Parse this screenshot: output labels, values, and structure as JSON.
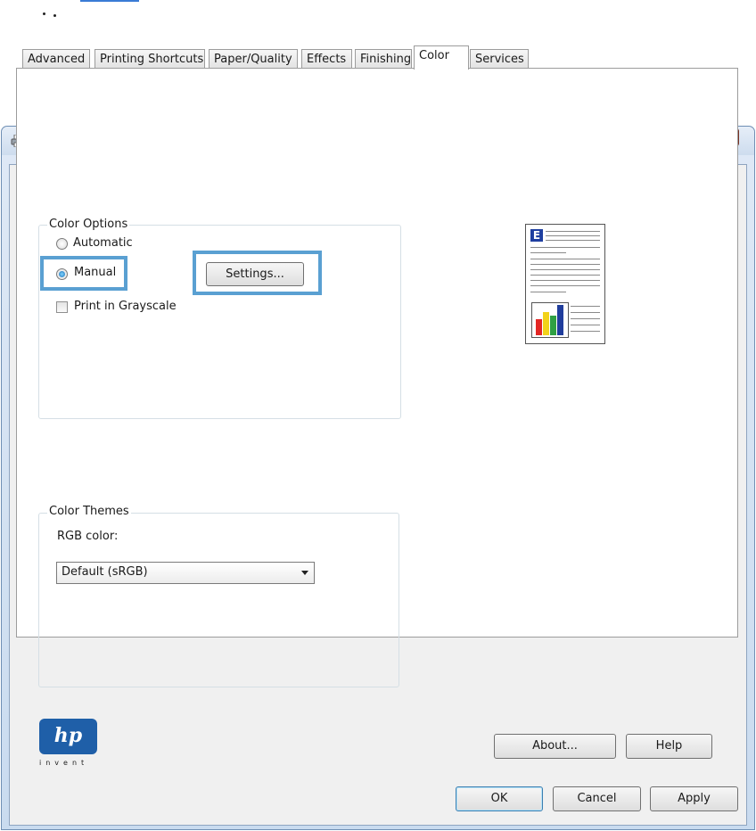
{
  "window": {
    "close_label": "x",
    "tabs": [
      "Advanced",
      "Printing Shortcuts",
      "Paper/Quality",
      "Effects",
      "Finishing",
      "Color",
      "Services"
    ],
    "active_tab": "Color"
  },
  "color_options": {
    "legend": "Color Options",
    "automatic_label": "Automatic",
    "manual_label": "Manual",
    "selected": "Manual",
    "settings_button": "Settings...",
    "grayscale_label": "Print in Grayscale",
    "grayscale_checked": false
  },
  "color_themes": {
    "legend": "Color Themes",
    "rgb_label": "RGB color:",
    "rgb_value": "Default (sRGB)"
  },
  "preview": {
    "letter": "E",
    "bar_colors": [
      "#e32624",
      "#f2d21b",
      "#2fa043",
      "#203d9c"
    ]
  },
  "logo": {
    "text": "hp",
    "tagline": "invent",
    "color": "#1f5fa8"
  },
  "buttons": {
    "about": "About...",
    "help": "Help",
    "ok": "OK",
    "cancel": "Cancel",
    "apply": "Apply"
  },
  "accent_color": "#5aa0d2"
}
